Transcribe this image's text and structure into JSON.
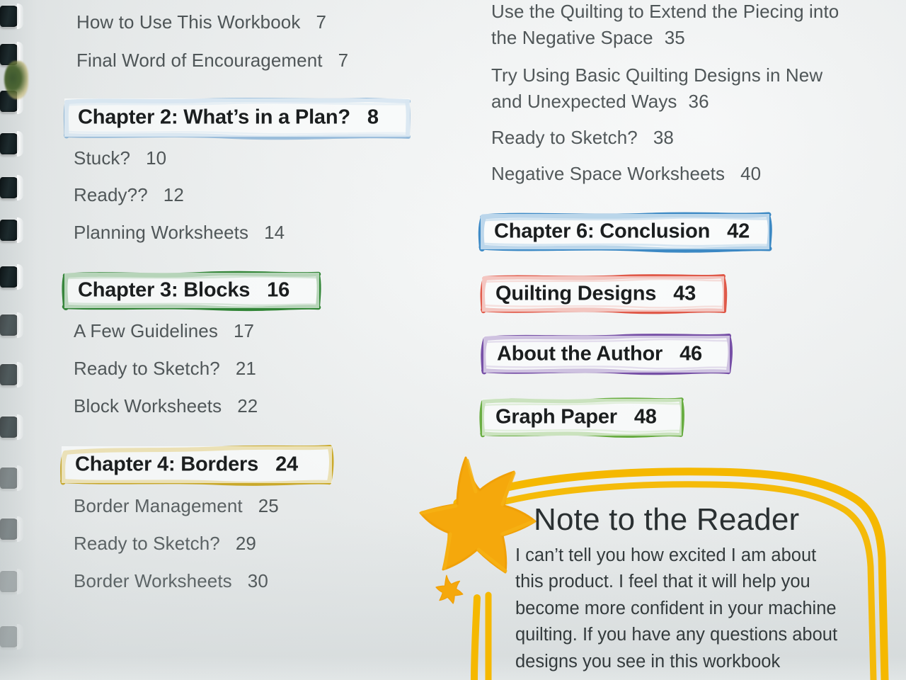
{
  "page": {
    "type": "table-of-contents",
    "paper_color": "#eef1f1"
  },
  "left_column": {
    "entries": [
      {
        "id": "how-to-use",
        "title": "How to Use This Workbook",
        "page": "7",
        "style": "plain"
      },
      {
        "id": "final-word",
        "title": "Final Word of Encouragement",
        "page": "7",
        "style": "plain"
      },
      {
        "id": "chapter-2",
        "title": "Chapter 2: What’s in a Plan?",
        "page": "8",
        "style": "boxed",
        "color": "#8ab4d8",
        "color_name": "light-blue"
      },
      {
        "id": "stuck",
        "title": "Stuck?",
        "page": "10",
        "style": "plain"
      },
      {
        "id": "ready",
        "title": "Ready??",
        "page": "12",
        "style": "plain"
      },
      {
        "id": "planning-worksheets",
        "title": "Planning Worksheets",
        "page": "14",
        "style": "plain"
      },
      {
        "id": "chapter-3",
        "title": "Chapter 3: Blocks",
        "page": "16",
        "style": "boxed",
        "color": "#1d7a22",
        "color_name": "dark-green"
      },
      {
        "id": "a-few-guidelines",
        "title": "A Few Guidelines",
        "page": "17",
        "style": "plain"
      },
      {
        "id": "ready-to-sketch-21",
        "title": "Ready to Sketch?",
        "page": "21",
        "style": "plain"
      },
      {
        "id": "block-worksheets",
        "title": "Block Worksheets",
        "page": "22",
        "style": "plain"
      },
      {
        "id": "chapter-4",
        "title": "Chapter 4: Borders",
        "page": "24",
        "style": "boxed",
        "color": "#c9a417",
        "color_name": "gold"
      },
      {
        "id": "border-management",
        "title": "Border Management",
        "page": "25",
        "style": "plain"
      },
      {
        "id": "ready-to-sketch-29",
        "title": "Ready to Sketch?",
        "page": "29",
        "style": "plain"
      },
      {
        "id": "border-worksheets",
        "title": "Border Worksheets",
        "page": "30",
        "style": "plain"
      }
    ]
  },
  "right_column": {
    "entries": [
      {
        "id": "use-quilting-extend",
        "title": "Use the Quilting to Extend the Piecing into the Negative Space",
        "page": "35",
        "style": "plain-wrap"
      },
      {
        "id": "try-basic-designs",
        "title": "Try Using Basic Quilting Designs in New and Unexpected Ways",
        "page": "36",
        "style": "plain-wrap"
      },
      {
        "id": "ready-to-sketch-38",
        "title": "Ready to Sketch?",
        "page": "38",
        "style": "plain"
      },
      {
        "id": "negative-space-worksheets",
        "title": "Negative Space Worksheets",
        "page": "40",
        "style": "plain"
      },
      {
        "id": "chapter-6",
        "title": "Chapter 6: Conclusion",
        "page": "42",
        "style": "boxed",
        "color": "#2a7fc1",
        "color_name": "blue"
      },
      {
        "id": "quilting-designs",
        "title": "Quilting Designs",
        "page": "43",
        "style": "boxed",
        "color": "#e04a38",
        "color_name": "red"
      },
      {
        "id": "about-the-author",
        "title": "About the Author",
        "page": "46",
        "style": "boxed",
        "color": "#6b3fa0",
        "color_name": "purple"
      },
      {
        "id": "graph-paper",
        "title": "Graph Paper",
        "page": "48",
        "style": "boxed",
        "color": "#5ca830",
        "color_name": "light-green"
      }
    ]
  },
  "note": {
    "title": "Note to the Reader",
    "body": "I can’t tell you how excited I am about this product. I feel that it will help you become more confident in your machine quilting. If you have any questions about designs you see in this workbook",
    "frame_color": "#f5b800",
    "star_color": "#f5a80c"
  },
  "binding": {
    "hole_color": "#162124",
    "count": 13
  }
}
